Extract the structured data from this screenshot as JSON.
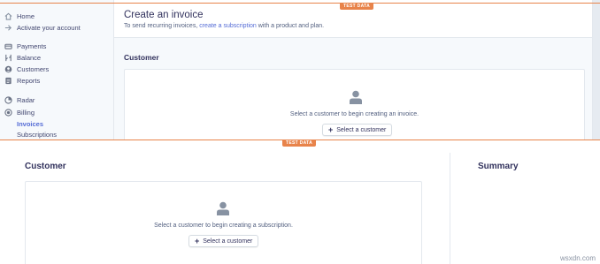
{
  "sidebar": {
    "items": [
      {
        "label": "Home",
        "icon": "home-icon"
      },
      {
        "label": "Activate your account",
        "icon": "arrow-right-icon"
      },
      {
        "label": "Payments",
        "icon": "payments-icon"
      },
      {
        "label": "Balance",
        "icon": "balance-icon"
      },
      {
        "label": "Customers",
        "icon": "customers-icon"
      },
      {
        "label": "Reports",
        "icon": "reports-icon"
      },
      {
        "label": "Radar",
        "icon": "radar-icon"
      },
      {
        "label": "Billing",
        "icon": "billing-icon"
      },
      {
        "label": "Invoices",
        "icon": ""
      },
      {
        "label": "Subscriptions",
        "icon": ""
      }
    ],
    "active_item": "Invoices"
  },
  "invoice": {
    "test_badge": "TEST DATA",
    "title": "Create an invoice",
    "subtitle_before": "To send recurring invoices,",
    "subtitle_link": "create a subscription",
    "subtitle_after": "with a product and plan.",
    "customer_heading": "Customer",
    "empty_message": "Select a customer to begin creating an invoice.",
    "select_button": "Select a customer"
  },
  "subscription": {
    "test_badge": "TEST DATA",
    "customer_heading": "Customer",
    "summary_heading": "Summary",
    "empty_message": "Select a customer to begin creating a subscription.",
    "select_button": "Select a customer"
  },
  "watermark": "wsxdn.com",
  "colors": {
    "accent": "#556cd6",
    "test_badge": "#e8834a",
    "sidebar_bg": "#f6f9fc"
  }
}
